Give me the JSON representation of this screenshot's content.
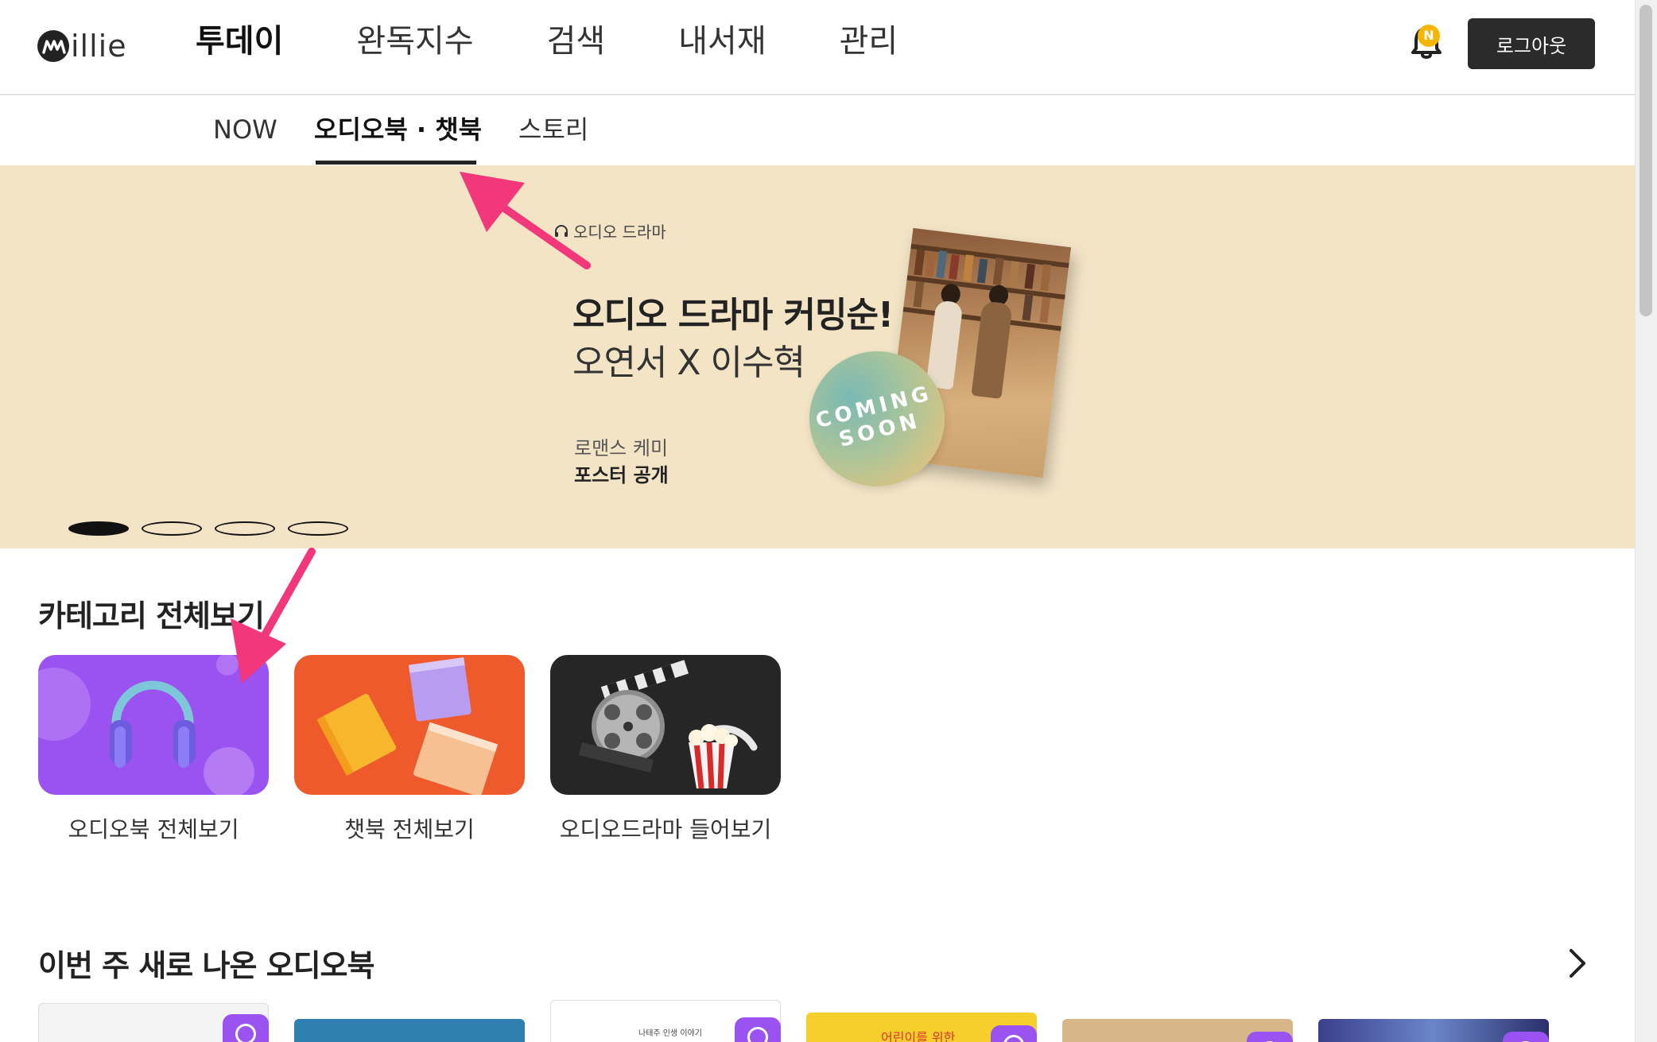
{
  "brand": {
    "logo_text": "illie"
  },
  "mainnav": {
    "items": [
      {
        "label": "투데이",
        "active": true
      },
      {
        "label": "완독지수",
        "active": false
      },
      {
        "label": "검색",
        "active": false
      },
      {
        "label": "내서재",
        "active": false
      },
      {
        "label": "관리",
        "active": false
      }
    ]
  },
  "header": {
    "bell_badge": "N",
    "logout_label": "로그아웃"
  },
  "subtabs": {
    "items": [
      {
        "label": "NOW",
        "active": false
      },
      {
        "label": "오디오북 · 챗북",
        "active": true
      },
      {
        "label": "스토리",
        "active": false
      }
    ]
  },
  "banner": {
    "eyebrow": "오디오 드라마",
    "title": "오디오 드라마 커밍순!",
    "subtitle": "오연서 X 이수혁",
    "tag": "로맨스 케미",
    "tag_bold": "포스터 공개",
    "stamp_line1": "COMING",
    "stamp_line2": "SOON",
    "background_color": "#f3e4c6",
    "slide_count": 4,
    "active_slide": 1
  },
  "categories": {
    "title": "카테고리 전체보기",
    "items": [
      {
        "label": "오디오북 전체보기",
        "color": "#9a52f0",
        "icon": "headphones-icon"
      },
      {
        "label": "챗북 전체보기",
        "color": "#ee5a2b",
        "icon": "books-icon"
      },
      {
        "label": "오디오드라마 들어보기",
        "color": "#262626",
        "icon": "film-popcorn-icon"
      }
    ]
  },
  "new_audiobooks": {
    "title": "이번 주 새로 나온 오디오북",
    "visible_book_text": [
      "나태주 인생 이야기",
      "어린이를 위한"
    ]
  },
  "colors": {
    "accent_purple": "#9a52f0",
    "annotation_pink": "#f2387a",
    "dark_button": "#2b2b2b",
    "badge_yellow": "#f6b500"
  }
}
